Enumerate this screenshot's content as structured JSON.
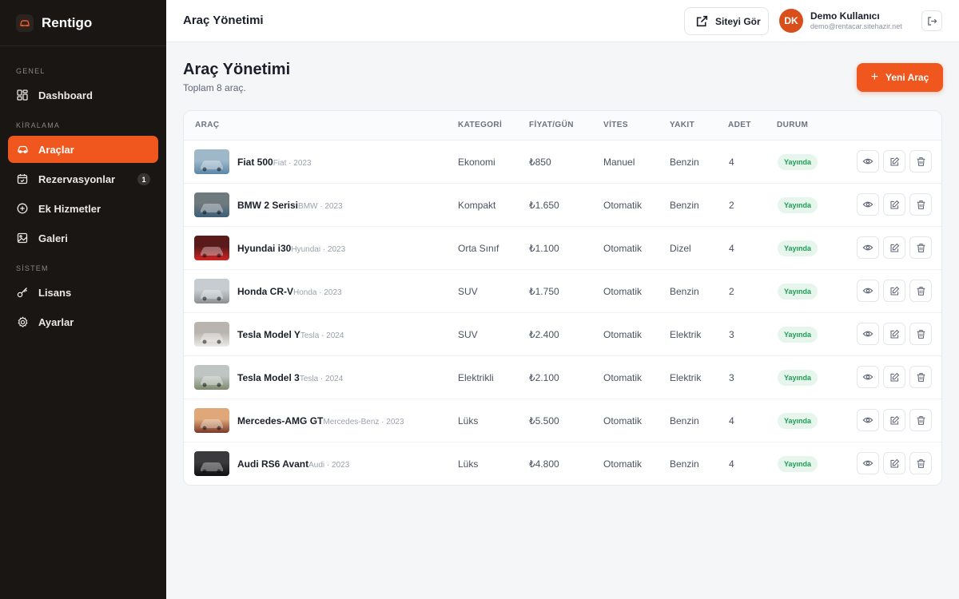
{
  "app": {
    "name": "Rentigo"
  },
  "sidebar": {
    "sections": [
      {
        "label": "GENEL"
      },
      {
        "label": "KİRALAMA"
      },
      {
        "label": "SİSTEM"
      }
    ],
    "items": [
      {
        "label": "Dashboard",
        "icon": "dashboard-icon"
      },
      {
        "label": "Araçlar",
        "icon": "car-icon",
        "active": true
      },
      {
        "label": "Rezervasyonlar",
        "icon": "calendar-icon",
        "badge": "1"
      },
      {
        "label": "Ek Hizmetler",
        "icon": "plus-circle-icon"
      },
      {
        "label": "Galeri",
        "icon": "image-icon"
      },
      {
        "label": "Lisans",
        "icon": "key-icon"
      },
      {
        "label": "Ayarlar",
        "icon": "gear-icon"
      }
    ]
  },
  "topbar": {
    "title": "Araç Yönetimi",
    "site_button": "Siteyi Gör",
    "user": {
      "initials": "DK",
      "name": "Demo Kullanıcı",
      "email": "demo@rentacar.sitehazir.net"
    }
  },
  "header": {
    "title": "Araç Yönetimi",
    "subtitle": "Toplam 8 araç.",
    "new_button": "Yeni Araç"
  },
  "table": {
    "columns": [
      "ARAÇ",
      "KATEGORİ",
      "FİYAT/GÜN",
      "VİTES",
      "YAKIT",
      "ADET",
      "DURUM"
    ],
    "rows": [
      {
        "name": "Fiat 500",
        "meta": "Fiat · 2023",
        "category": "Ekonomi",
        "price": "₺850",
        "gear": "Manuel",
        "fuel": "Benzin",
        "qty": "4",
        "status": "Yayında",
        "thumb": [
          "#9fb8c9",
          "#5b87a8"
        ]
      },
      {
        "name": "BMW 2 Serisi",
        "meta": "BMW · 2023",
        "category": "Kompakt",
        "price": "₺1.650",
        "gear": "Otomatik",
        "fuel": "Benzin",
        "qty": "2",
        "status": "Yayında",
        "thumb": [
          "#6f7a7e",
          "#3d5f78"
        ]
      },
      {
        "name": "Hyundai i30",
        "meta": "Hyundai · 2023",
        "category": "Orta Sınıf",
        "price": "₺1.100",
        "gear": "Otomatik",
        "fuel": "Dizel",
        "qty": "4",
        "status": "Yayında",
        "thumb": [
          "#5a1a1a",
          "#d02424"
        ]
      },
      {
        "name": "Honda CR-V",
        "meta": "Honda · 2023",
        "category": "SUV",
        "price": "₺1.750",
        "gear": "Otomatik",
        "fuel": "Benzin",
        "qty": "2",
        "status": "Yayında",
        "thumb": [
          "#c7ccd0",
          "#8b8f92"
        ]
      },
      {
        "name": "Tesla Model Y",
        "meta": "Tesla · 2024",
        "category": "SUV",
        "price": "₺2.400",
        "gear": "Otomatik",
        "fuel": "Elektrik",
        "qty": "3",
        "status": "Yayında",
        "thumb": [
          "#b9b4ae",
          "#ecebe9"
        ]
      },
      {
        "name": "Tesla Model 3",
        "meta": "Tesla · 2024",
        "category": "Elektrikli",
        "price": "₺2.100",
        "gear": "Otomatik",
        "fuel": "Elektrik",
        "qty": "3",
        "status": "Yayında",
        "thumb": [
          "#bfc5c2",
          "#7c8a6d"
        ]
      },
      {
        "name": "Mercedes-AMG GT",
        "meta": "Mercedes-Benz · 2023",
        "category": "Lüks",
        "price": "₺5.500",
        "gear": "Otomatik",
        "fuel": "Benzin",
        "qty": "4",
        "status": "Yayında",
        "thumb": [
          "#e0a878",
          "#7a3a2a"
        ]
      },
      {
        "name": "Audi RS6 Avant",
        "meta": "Audi · 2023",
        "category": "Lüks",
        "price": "₺4.800",
        "gear": "Otomatik",
        "fuel": "Benzin",
        "qty": "4",
        "status": "Yayında",
        "thumb": [
          "#3a3a3c",
          "#101012"
        ]
      }
    ],
    "actions": [
      {
        "icon": "eye-icon"
      },
      {
        "icon": "edit-icon"
      },
      {
        "icon": "trash-icon"
      }
    ]
  },
  "colors": {
    "accent": "#f0571f",
    "sidebar_bg": "#1a1614",
    "status_green": "#1f9d55"
  }
}
